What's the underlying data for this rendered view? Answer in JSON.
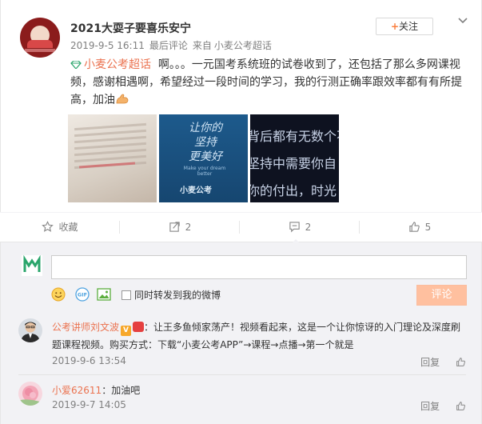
{
  "post": {
    "username": "2021大耍子要喜乐安宁",
    "meta": {
      "datetime": "2019-9-5 16:11",
      "last_comment": "最后评论",
      "source_prefix": "来自",
      "source": "小麦公考超话"
    },
    "follow_label": "关注",
    "content": {
      "topic": "小麦公考超话",
      "text": "啊。。。一元国考系统班的试卷收到了，还包括了那么多网课视频，感谢相遇啊，希望经过一段时间的学习，我的行测正确率跟效率都有有所提高，加油"
    },
    "images": {
      "pic2_handwriting": "让你的\n坚持\n更美好",
      "pic2_sub": "Make your dream better",
      "pic2_logo": "小麦公考",
      "pic3_lines": [
        "背后都有无数个不",
        "坚持中需要你自",
        "你的付出，时光"
      ]
    }
  },
  "actions": {
    "favorite": "收藏",
    "repost_count": "2",
    "comment_count": "2",
    "like_count": "5"
  },
  "comment_box": {
    "placeholder": "",
    "also_repost": "同时转发到我的微博",
    "submit": "评论",
    "gif": "GIF"
  },
  "comments": [
    {
      "name": "公考讲师刘文波",
      "text": "：让王多鱼倾家荡产！视频看起来，这是一个让你惊讶的入门理论及深度刷题课程视频。购买方式：下载“小麦公考APP”→课程→点播→第一个就是",
      "time": "2019-9-6 13:54",
      "reply": "回复"
    },
    {
      "name": "小爱62611",
      "text": "：加油吧",
      "time": "2019-9-7 14:05",
      "reply": "回复"
    }
  ],
  "colors": {
    "accent": "#eb7350",
    "follow_plus": "#fa7d3c",
    "submit_disabled": "#ffc09f",
    "brand_green": "#2aa56b"
  }
}
